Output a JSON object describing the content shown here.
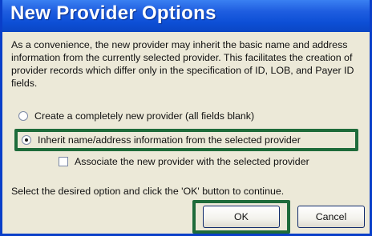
{
  "window": {
    "title": "New Provider Options"
  },
  "description": "As a convenience, the new provider may inherit the basic name and address information from the currently selected provider. This facilitates the creation of provider records which differ only in the specification of ID, LOB, and Payer ID fields.",
  "options": {
    "create_new_label": "Create a completely new provider (all fields blank)",
    "inherit_label": "Inherit name/address information from the selected provider",
    "associate_label": "Associate the new provider with the selected provider",
    "selected": "inherit",
    "associate_checked": false
  },
  "hint": "Select the desired option and click the 'OK' button to continue.",
  "buttons": {
    "ok_label": "OK",
    "cancel_label": "Cancel"
  },
  "colors": {
    "titlebar": "#0d4fd6",
    "highlight": "#1e6b3a",
    "dialog_bg": "#ece9d8"
  }
}
